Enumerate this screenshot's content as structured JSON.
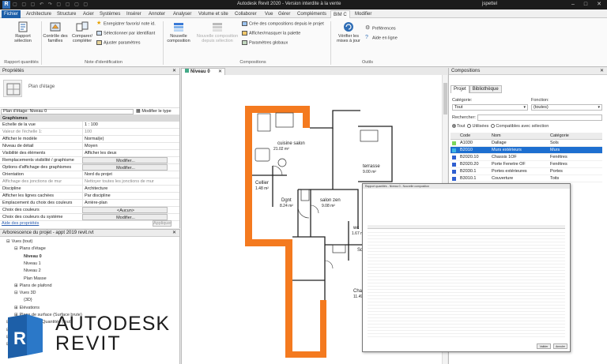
{
  "window": {
    "app_icon": "R",
    "title": "Autodesk Revit 2020 - Version interdite à la vente",
    "user": "jspettel",
    "qat_glyphs": "▢ ▢ ▢ ↶ ↷ ▢ ▢ ▢ ▢",
    "controls": {
      "minimize": "–",
      "maximize": "□",
      "close": "✕"
    }
  },
  "ribbon_tabs": [
    "Fichier",
    "Architecture",
    "Structure",
    "Acier",
    "Systèmes",
    "Insérer",
    "Annoter",
    "Analyser",
    "Volume et site",
    "Collaborer",
    "Vue",
    "Gérer",
    "Compléments",
    "BIM C",
    "Modifier"
  ],
  "ribbon": {
    "report_btn": "Rapport\nsélection",
    "families_btn": "Contrôle des\nfamilles",
    "compare_btn": "Comparer/\ncompléter",
    "save_fav": "Enregistrer favoris/ note id.",
    "select_by_id": "Sélectionner par identifiant",
    "adjust_params": "Ajuster paramètres",
    "new_comp_btn": "Nouvelle\ncomposition",
    "new_comp_from_sel": "Nouvelle composition\ndepuis sélection",
    "create_comps_from_project": "Crée des compositions depuis le projet",
    "show_hide_palette": "Afficher/masquer la palette",
    "global_params": "Paramètres globaux",
    "check_updates": "Vérifier les\nmises à jour",
    "preferences": "Préférences",
    "online_help": "Aide en ligne",
    "panel_labels": [
      "Rapport quantités",
      "Note d'identification",
      "Compositions",
      "Outils"
    ]
  },
  "properties": {
    "title": "Propriétés",
    "close": "✕",
    "type_name": "Plan d'étage",
    "filter_value": "Plan d'étage: Niveau 0",
    "edit_type": "Modifier le type",
    "group": "Graphismes",
    "rows": [
      {
        "k": "Echelle de la vue",
        "v": "1 : 100",
        "gray": false,
        "btn": false
      },
      {
        "k": "Valeur de l'échelle    1:",
        "v": "100",
        "gray": true,
        "btn": false
      },
      {
        "k": "Afficher le modèle",
        "v": "Normal(e)",
        "gray": false,
        "btn": false
      },
      {
        "k": "Niveau de détail",
        "v": "Moyen",
        "gray": false,
        "btn": false
      },
      {
        "k": "Visibilité des éléments",
        "v": "Afficher les deux",
        "gray": false,
        "btn": false
      },
      {
        "k": "Remplacements visibilité / graphisme",
        "v": "Modifier...",
        "gray": false,
        "btn": true
      },
      {
        "k": "Options d'affichage des graphismes",
        "v": "Modifier...",
        "gray": false,
        "btn": true
      },
      {
        "k": "Orientation",
        "v": "Nord du projet",
        "gray": false,
        "btn": false
      },
      {
        "k": "Affichage des jonctions de mur",
        "v": "Nettoyer toutes les jonctions de mur",
        "gray": true,
        "btn": false
      },
      {
        "k": "Discipline",
        "v": "Architecture",
        "gray": false,
        "btn": false
      },
      {
        "k": "Afficher les lignes cachées",
        "v": "Par discipline",
        "gray": false,
        "btn": false
      },
      {
        "k": "Emplacement du choix des couleurs",
        "v": "Arrière-plan",
        "gray": false,
        "btn": false
      },
      {
        "k": "Choix des couleurs",
        "v": "<Aucun>",
        "gray": false,
        "btn": true
      },
      {
        "k": "Choix des couleurs du système",
        "v": "Modifier...",
        "gray": false,
        "btn": true
      }
    ],
    "help_link": "Aide des propriétés",
    "apply": "Appliquer"
  },
  "browser": {
    "title": "Arborescence du projet - appt 2019 revit.rvt",
    "close": "✕",
    "nodes": [
      {
        "label": "Vues (tout)",
        "indent": 0,
        "bold": false,
        "sign": "⊟"
      },
      {
        "label": "Plans d'étage",
        "indent": 1,
        "bold": false,
        "sign": "⊟"
      },
      {
        "label": "Niveau 0",
        "indent": 2,
        "bold": true,
        "sign": ""
      },
      {
        "label": "Niveau 1",
        "indent": 2,
        "bold": false,
        "sign": ""
      },
      {
        "label": "Niveau 2",
        "indent": 2,
        "bold": false,
        "sign": ""
      },
      {
        "label": "Plan Masse",
        "indent": 2,
        "bold": false,
        "sign": ""
      },
      {
        "label": "Plans de plafond",
        "indent": 1,
        "bold": false,
        "sign": "⊞"
      },
      {
        "label": "Vues 3D",
        "indent": 1,
        "bold": false,
        "sign": "⊟"
      },
      {
        "label": "{3D}",
        "indent": 2,
        "bold": false,
        "sign": ""
      },
      {
        "label": "Elévations",
        "indent": 1,
        "bold": false,
        "sign": "⊞"
      },
      {
        "label": "Plans de surface (Surface brute)",
        "indent": 1,
        "bold": false,
        "sign": "⊞"
      },
      {
        "label": "Nomenclatures/Quantités (tout)",
        "indent": 0,
        "bold": false,
        "sign": "⊞"
      },
      {
        "label": "Feuilles (tout)",
        "indent": 0,
        "bold": false,
        "sign": "⊞"
      },
      {
        "label": "Familles",
        "indent": 0,
        "bold": false,
        "sign": "⊞"
      },
      {
        "label": "Groupes",
        "indent": 0,
        "bold": false,
        "sign": "⊞"
      }
    ]
  },
  "watermark": {
    "brand": "AUTODESK",
    "product": "REVIT"
  },
  "view": {
    "tab_label": "Niveau 0",
    "close": "✕",
    "rooms": [
      {
        "name": "cuisine salon",
        "area": "21.02 m²"
      },
      {
        "name": "Cellier",
        "area": "1.48 m²"
      },
      {
        "name": "Dgnt",
        "area": "8.24 m²"
      },
      {
        "name": "salon zen",
        "area": "9.08 m²"
      },
      {
        "name": "terrasse",
        "area": "9.00 m²"
      },
      {
        "name": "wc",
        "area": "1.67 m²"
      },
      {
        "name": "Sdb",
        "area": ""
      },
      {
        "name": "Cham",
        "area": "11.49"
      }
    ]
  },
  "compositions": {
    "title": "Compositions",
    "close": "✕",
    "tabs": [
      "Projet",
      "Bibliothèque"
    ],
    "category_label": "Catégorie:",
    "category_value": "Tout",
    "function_label": "Fonction:",
    "function_value": "(toutes)",
    "search_label": "Rechercher:",
    "filter_all": "Tout",
    "filter_used": "Utilisées",
    "filter_compatible": "Compatibles avec sélection",
    "columns": [
      "Code",
      "Nom",
      "Catégorie"
    ],
    "rows": [
      {
        "code": "A1030",
        "name": "Dallage",
        "cat": "Sols",
        "color": "#7fd65c",
        "sel": false
      },
      {
        "code": "B2010",
        "name": "Murs extérieurs",
        "cat": "Murs",
        "color": "#3fb6e6",
        "sel": true
      },
      {
        "code": "B2020.10",
        "name": "Chassis 1OF",
        "cat": "Fenêtres",
        "color": "#2f5fd0",
        "sel": false
      },
      {
        "code": "B2020.20",
        "name": "Porte Fenetre OF",
        "cat": "Fenêtres",
        "color": "#2f5fd0",
        "sel": false
      },
      {
        "code": "B2030.1",
        "name": "Portes extérieures",
        "cat": "Portes",
        "color": "#2f5fd0",
        "sel": false
      },
      {
        "code": "B3010.1",
        "name": "Couverture",
        "cat": "Toits",
        "color": "#2f5fd0",
        "sel": false
      }
    ]
  },
  "schedule_popup": {
    "title": "Rapport quantités - Niveau 0 - Nouvelle composition",
    "ok": "Valider",
    "cancel": "Annuler"
  },
  "colors": {
    "file_tab": "#1d5fa8",
    "wall_orange": "#f47a1f",
    "selection_blue": "#1e6fd0"
  }
}
